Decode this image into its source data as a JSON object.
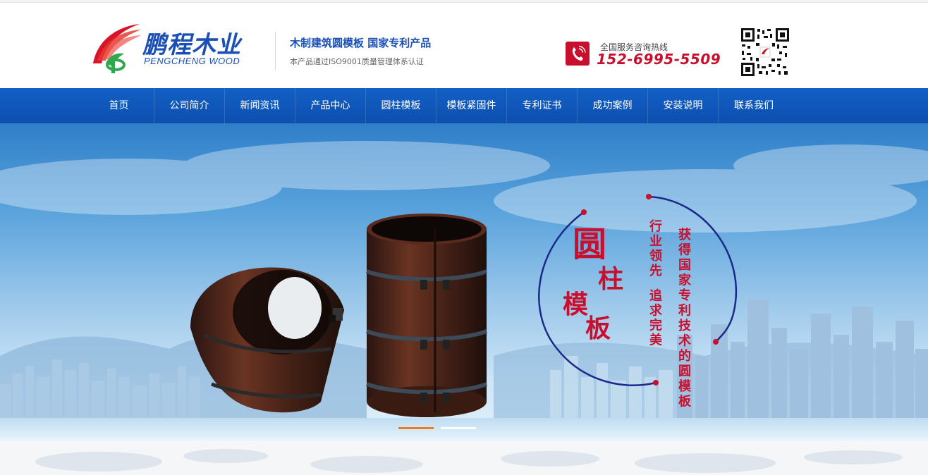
{
  "brand": {
    "name_cn": "鹏程木业",
    "name_en": "PENGCHENG WOOD"
  },
  "slogan": {
    "title": "木制建筑圆模板 国家专利产品",
    "subtitle": "本产品通过ISO9001质量管理体系认证"
  },
  "hotline": {
    "label": "全国服务咨询热线",
    "number": "152-6995-5509",
    "icon": "phone-icon"
  },
  "nav": {
    "items": [
      {
        "label": "首页"
      },
      {
        "label": "公司简介"
      },
      {
        "label": "新闻资讯"
      },
      {
        "label": "产品中心"
      },
      {
        "label": "圆柱模板"
      },
      {
        "label": "模板紧固件"
      },
      {
        "label": "专利证书"
      },
      {
        "label": "成功案例"
      },
      {
        "label": "安装说明"
      },
      {
        "label": "联系我们"
      }
    ]
  },
  "banner": {
    "title_chars": [
      "圆",
      "柱",
      "模",
      "板"
    ],
    "slogan_left": "行业领先 追求完美",
    "slogan_right": "获得国家专利技术的圆模板",
    "active_slide": 1,
    "slide_count": 2
  },
  "colors": {
    "brand_blue": "#1a4fb5",
    "nav_blue": "#0c4fae",
    "accent_red": "#c8102e",
    "active_dot": "#ee7a23"
  }
}
